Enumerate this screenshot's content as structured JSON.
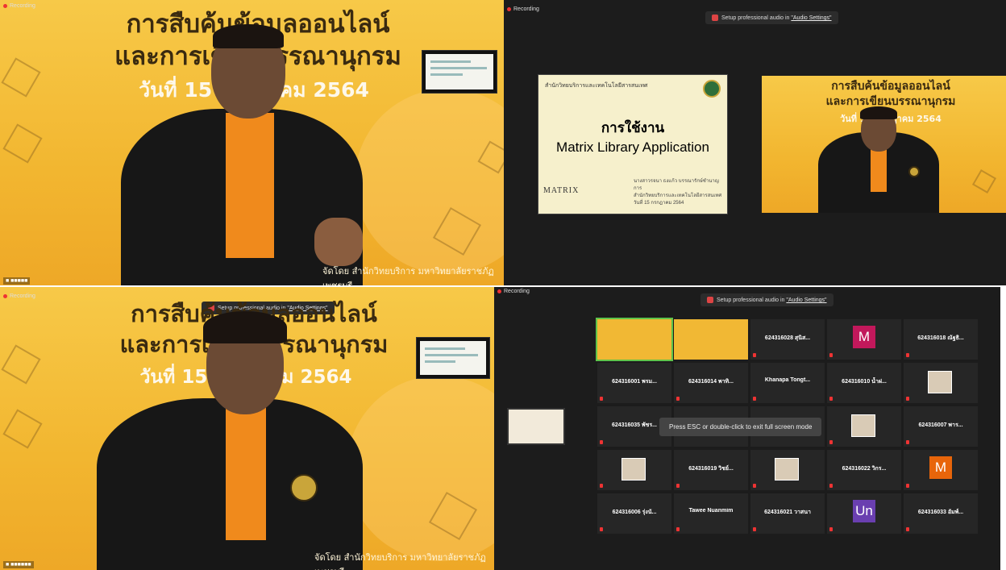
{
  "banner": {
    "title_line1": "การสืบค้นข้อมูลออนไลน์",
    "title_line2": "และการเขียนบรรณานุกรม",
    "date": "วันที่ 15 กรกฎาคม 2564",
    "footer": "จัดโดย สำนักวิทยบริการ มหาวิทยาลัยราชภัฏเพชรบุรี"
  },
  "recording_label": "Recording",
  "top_pill": {
    "text": "Setup professional audio in",
    "link": "\"Audio Settings\""
  },
  "slide": {
    "header": "สำนักวิทยบริการและเทคโนโลยีสารสนเทศ",
    "title": "การใช้งาน",
    "subtitle": "Matrix Library Application",
    "logo_text": "MATRIX",
    "presenter_line1": "นางสาวรจนา ธงแก้ว บรรณารักษ์ชำนาญการ",
    "presenter_line2": "สำนักวิทยบริการและเทคโนโลยีสารสนเทศ",
    "presenter_line3": "วันที่ 15 กรกฎาคม 2564"
  },
  "esc_toast": "Press ESC or double-click to exit full screen mode",
  "participants": [
    {
      "name": "624316028 สุนิส...",
      "avatar": "M",
      "avatar_color": "#c2185b"
    },
    {
      "name": "624316018 ณัฐธิ...",
      "avatar": "",
      "avatar_color": ""
    },
    {
      "name": "624316001 พรม...",
      "avatar": "",
      "avatar_color": ""
    },
    {
      "name": "624316014 พาทิ...",
      "avatar": "",
      "avatar_color": ""
    },
    {
      "name": "Khanapa Tongt...",
      "avatar": "",
      "avatar_color": ""
    },
    {
      "name": "624316010 น้ำฝ...",
      "avatar": "",
      "avatar_color": ""
    },
    {
      "name": "624316035 พัชร...",
      "avatar": "",
      "avatar_color": ""
    },
    {
      "name": "624316007 พาร...",
      "avatar": "",
      "avatar_color": ""
    },
    {
      "name": "624316019 วิชย์...",
      "avatar": "",
      "avatar_color": ""
    },
    {
      "name": "624316022 วิกร...",
      "avatar": "M",
      "avatar_color": "#e8650a"
    },
    {
      "name": "624316006 รุ่งนั...",
      "avatar": "",
      "avatar_color": ""
    },
    {
      "name": "Tawee Nuanmim",
      "avatar": "",
      "avatar_color": ""
    },
    {
      "name": "624316021 วาสนา",
      "avatar": "Un",
      "avatar_color": "#6a3fb0"
    },
    {
      "name": "624316033 อัมพ์...",
      "avatar": "",
      "avatar_color": ""
    }
  ]
}
